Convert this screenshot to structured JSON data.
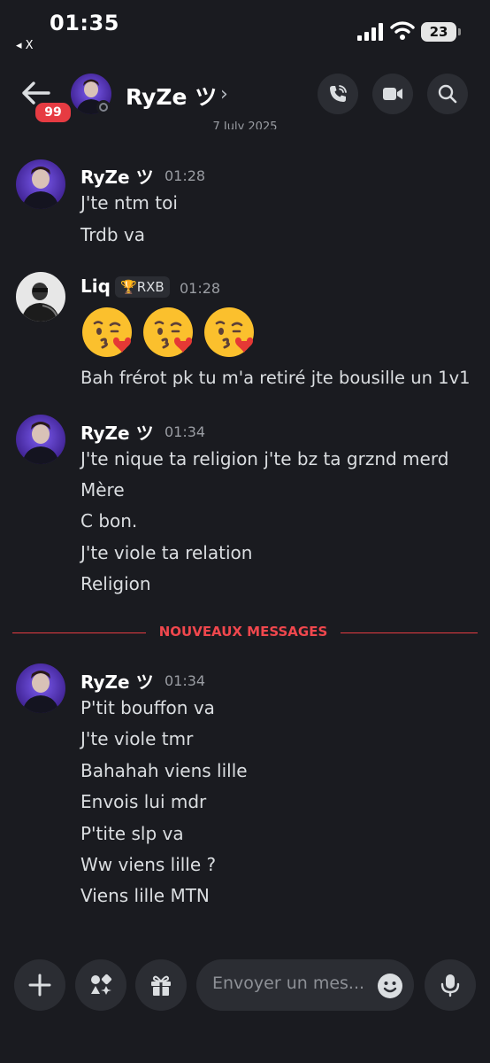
{
  "status_bar": {
    "time": "01:35",
    "back_app": "◂ X",
    "battery": "23"
  },
  "header": {
    "badge": "99",
    "name": "RyZe ツ",
    "chevron": "›"
  },
  "date_fragment": "7 July 2025",
  "messages": [
    {
      "author": "RyZe ツ",
      "time": "01:28",
      "lines": [
        "J'te ntm toi",
        "Trdb va"
      ]
    },
    {
      "author": "Liq",
      "role": "RXB",
      "time": "01:28",
      "emoji": [
        "kissing-face-with-heart",
        "kissing-face-with-heart",
        "kissing-face-with-heart"
      ],
      "lines": [
        "Bah frérot pk tu m'a retiré jte bousille un 1v1"
      ]
    },
    {
      "author": "RyZe ツ",
      "time": "01:34",
      "lines": [
        "J'te nique ta religion j'te bz ta grznd merd",
        "Mère",
        "C bon.",
        "J'te viole ta relation",
        "Religion"
      ]
    },
    {
      "author": "RyZe ツ",
      "time": "01:34",
      "lines": [
        "P'tit bouffon va",
        "J'te viole tmr",
        "Bahahah viens lille",
        "Envois lui mdr",
        "P'tite slp va",
        "Ww viens lille ?",
        "Viens lille MTN"
      ]
    }
  ],
  "new_messages_label": "NOUVEAUX MESSAGES",
  "composer": {
    "placeholder": "Envoyer un mes..."
  },
  "colors": {
    "background": "#1a1b20",
    "button": "#2b2d33",
    "accent_red": "#e63b42",
    "text": "#dbdee1"
  }
}
